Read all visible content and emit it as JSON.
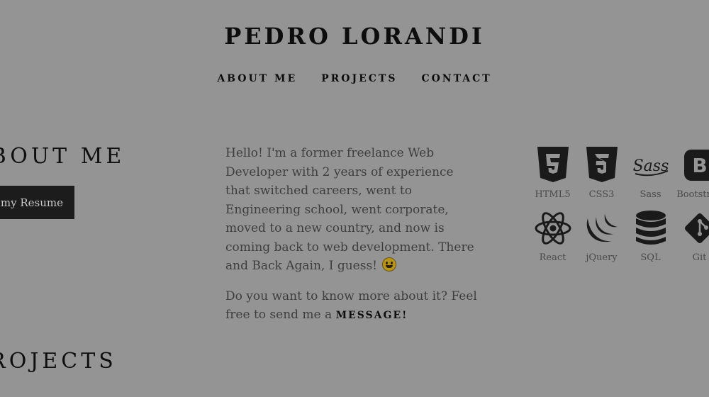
{
  "header": {
    "title": "PEDRO LORANDI"
  },
  "nav": [
    {
      "label": "ABOUT ME"
    },
    {
      "label": "PROJECTS"
    },
    {
      "label": "CONTACT"
    }
  ],
  "about": {
    "heading": "ABOUT ME",
    "resume_button": "See my Resume",
    "bio_text": "Hello! I'm a former freelance Web Developer with 2 years of experience that switched careers, went to Engineering school, went corporate, moved to a new country, and now is coming back to web development. There and Back Again, I guess!",
    "cta_text": "Do you want to know more about it? Feel free to send me a",
    "cta_link": "MESSAGE!"
  },
  "skills": [
    {
      "label": "HTML5",
      "icon": "html5-icon"
    },
    {
      "label": "CSS3",
      "icon": "css3-icon"
    },
    {
      "label": "Sass",
      "icon": "sass-icon"
    },
    {
      "label": "Bootstrap",
      "icon": "bootstrap-icon"
    },
    {
      "label": "React",
      "icon": "react-icon"
    },
    {
      "label": "jQuery",
      "icon": "jquery-icon"
    },
    {
      "label": "SQL",
      "icon": "database-icon"
    },
    {
      "label": "Git",
      "icon": "git-icon"
    }
  ],
  "projects": {
    "heading": "PROJECTS"
  },
  "colors": {
    "background": "#949494",
    "text_dark": "#0d0d0d",
    "button_bg": "#1c1c1c"
  }
}
